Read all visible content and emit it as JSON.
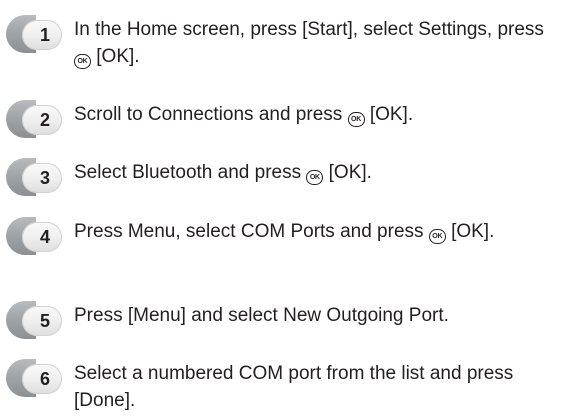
{
  "ok_key": {
    "icon": "ok-key-icon",
    "glyph": "OK"
  },
  "steps": [
    {
      "number": "1",
      "before": "In the Home screen, press [Start], select Settings, press ",
      "after": " [OK]."
    },
    {
      "number": "2",
      "before": "Scroll to Connections and press ",
      "after": " [OK]."
    },
    {
      "number": "3",
      "before": "Select Bluetooth and press ",
      "after": " [OK]."
    },
    {
      "number": "4",
      "before": "Press Menu, select COM Ports and press ",
      "after": " [OK]."
    },
    {
      "number": "5",
      "text": "Press [Menu] and select New Outgoing Port."
    },
    {
      "number": "6",
      "text": "Select a numbered COM port from the list and press [Done]."
    }
  ]
}
